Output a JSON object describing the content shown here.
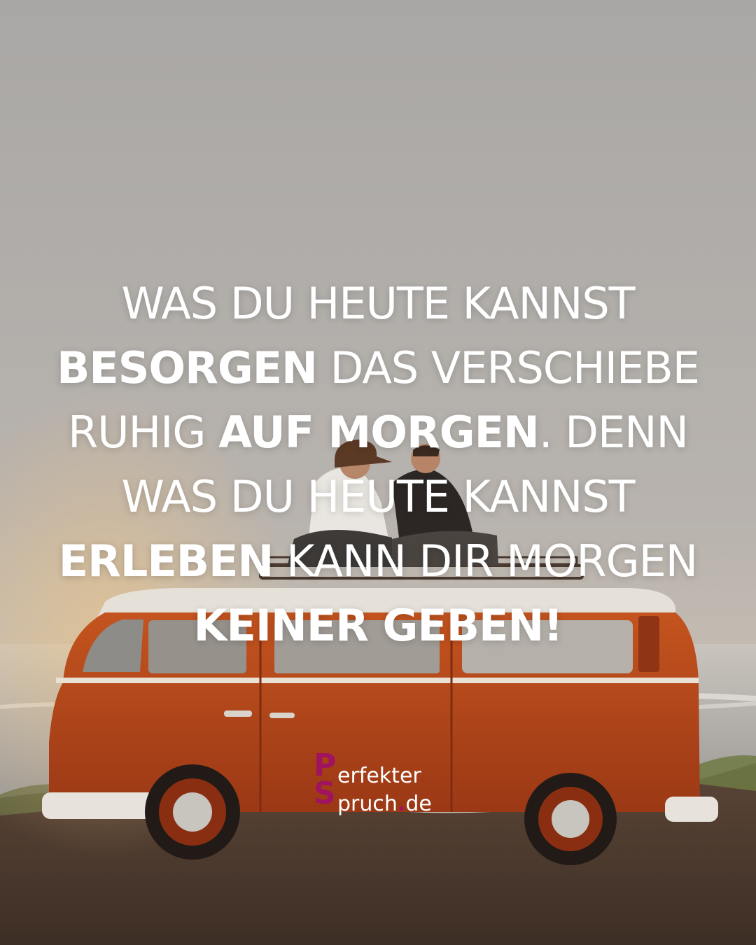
{
  "quote": {
    "lines": [
      [
        {
          "text": "WAS DU HEUTE KANNST",
          "bold": false
        }
      ],
      [
        {
          "text": "BESORGEN",
          "bold": true
        },
        {
          "text": " DAS VERSCHIEBE",
          "bold": false
        }
      ],
      [
        {
          "text": "RUHIG ",
          "bold": false
        },
        {
          "text": "AUF MORGEN",
          "bold": true
        },
        {
          "text": ". DENN",
          "bold": false
        }
      ],
      [
        {
          "text": "WAS DU HEUTE KANNST",
          "bold": false
        }
      ],
      [
        {
          "text": "ERLEBEN",
          "bold": true
        },
        {
          "text": " KANN DIR MORGEN",
          "bold": false
        }
      ],
      [
        {
          "text": "KEINER GEBEN!",
          "bold": true
        }
      ]
    ]
  },
  "logo": {
    "letter_p": "P",
    "letter_s": "S",
    "word_line1": "erfekter",
    "word_line2": "pruch",
    "dot": ".",
    "tld": "de"
  },
  "colors": {
    "sky": "#b3afab",
    "bus_orange": "#b7471b",
    "bus_roof": "#e7e3dc",
    "ground": "#4e3a2e",
    "logo_accent": "#a0135f",
    "text": "#ffffff"
  }
}
